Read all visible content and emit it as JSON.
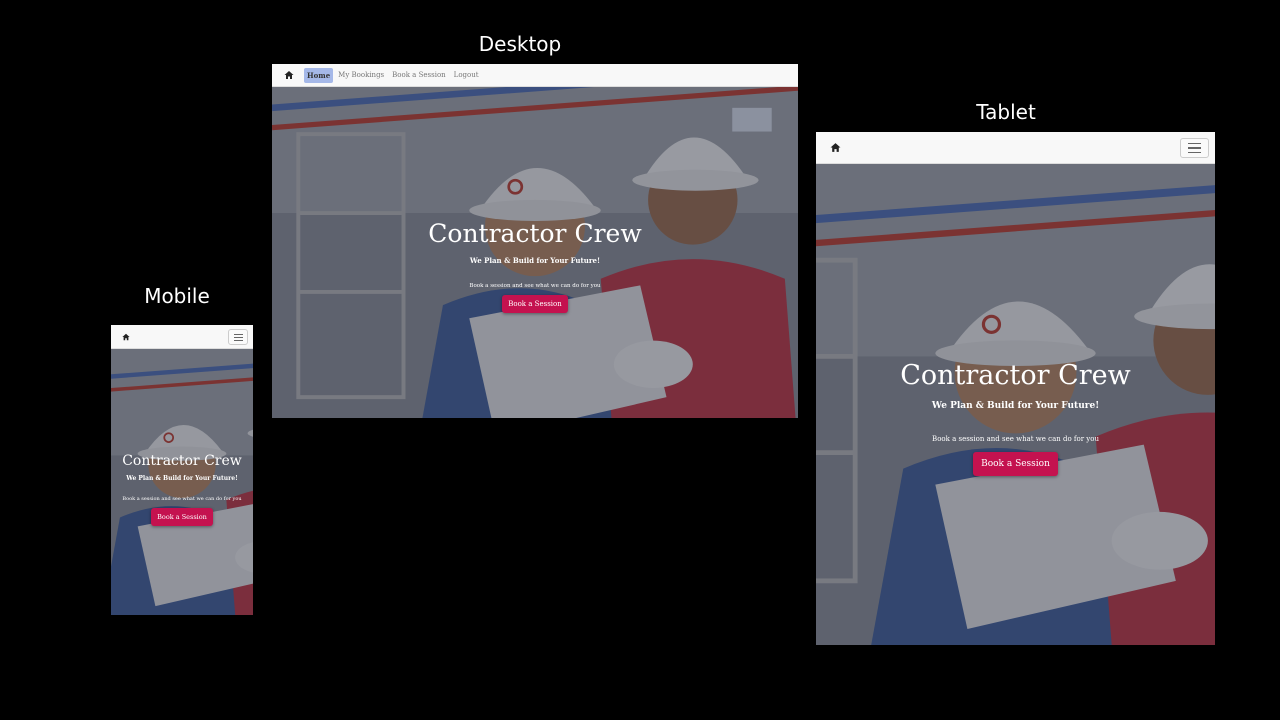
{
  "captions": {
    "desktop": "Desktop",
    "tablet": "Tablet",
    "mobile": "Mobile"
  },
  "site": {
    "nav_links": [
      "Home",
      "My Bookings",
      "Book a Session",
      "Logout"
    ],
    "active_link": "Home",
    "home_icon": "home-icon",
    "menu_icon": "hamburger-menu-icon",
    "hero": {
      "title": "Contractor Crew",
      "tagline": "We Plan & Build for Your Future!",
      "cta_text": "Book a session and see what we can do for you",
      "cta_button": "Book a Session"
    }
  },
  "colors": {
    "background": "#000000",
    "navbar": "#f8f8f8",
    "active_link_bg": "#a5b8e8",
    "cta_button": "#c4124f",
    "hero_text": "#ffffff"
  }
}
